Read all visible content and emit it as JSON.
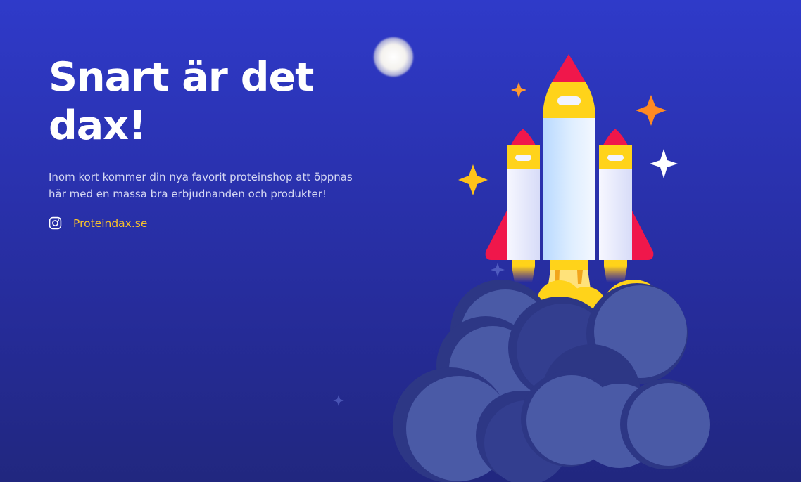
{
  "hero": {
    "headline_line1": "Snart är det",
    "headline_line2": "dax!",
    "intro_line1": "Inom kort kommer din nya favorit proteinshop att öppnas",
    "intro_line2": "här med en massa bra erbjudnanden och produkter!"
  },
  "social": {
    "icon": "instagram-icon",
    "link_label": "Proteindax.se"
  },
  "illustration": {
    "subject": "rocket-launch",
    "icons": [
      "moon-icon",
      "sparkle-icon",
      "rocket-icon",
      "smoke-cloud-icon"
    ]
  },
  "colors": {
    "background_top": "#2f3ac9",
    "background_bottom": "#21277f",
    "accent_link": "#f7c12c",
    "headline": "#ffffff",
    "rocket_nose": "#f0174b",
    "rocket_band": "#ffd31a",
    "cloud": "#4a5aa6"
  }
}
